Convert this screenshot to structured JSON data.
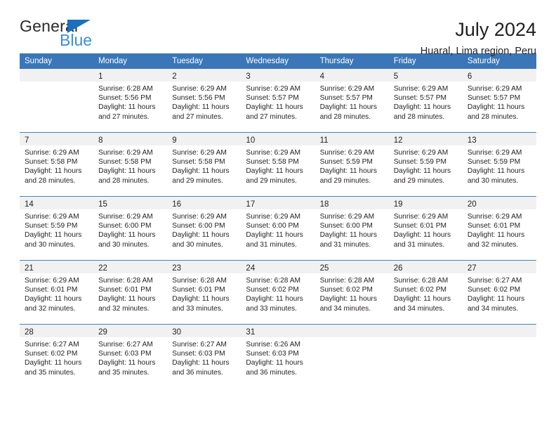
{
  "logo": {
    "word1": "General",
    "word2": "Blue",
    "triangle_color": "#1c6fc0",
    "word2_color": "#3d8dd6"
  },
  "header": {
    "title": "July 2024",
    "subtitle": "Huaral, Lima region, Peru",
    "header_bg": "#3a76b8",
    "daynum_bg": "#f1f1f1",
    "separator_color": "#4a7fbb"
  },
  "weekday_headers": [
    "Sunday",
    "Monday",
    "Tuesday",
    "Wednesday",
    "Thursday",
    "Friday",
    "Saturday"
  ],
  "weeks": [
    [
      {
        "day": "",
        "lines": []
      },
      {
        "day": "1",
        "lines": [
          "Sunrise: 6:28 AM",
          "Sunset: 5:56 PM",
          "Daylight: 11 hours",
          "and 27 minutes."
        ]
      },
      {
        "day": "2",
        "lines": [
          "Sunrise: 6:29 AM",
          "Sunset: 5:56 PM",
          "Daylight: 11 hours",
          "and 27 minutes."
        ]
      },
      {
        "day": "3",
        "lines": [
          "Sunrise: 6:29 AM",
          "Sunset: 5:57 PM",
          "Daylight: 11 hours",
          "and 27 minutes."
        ]
      },
      {
        "day": "4",
        "lines": [
          "Sunrise: 6:29 AM",
          "Sunset: 5:57 PM",
          "Daylight: 11 hours",
          "and 28 minutes."
        ]
      },
      {
        "day": "5",
        "lines": [
          "Sunrise: 6:29 AM",
          "Sunset: 5:57 PM",
          "Daylight: 11 hours",
          "and 28 minutes."
        ]
      },
      {
        "day": "6",
        "lines": [
          "Sunrise: 6:29 AM",
          "Sunset: 5:57 PM",
          "Daylight: 11 hours",
          "and 28 minutes."
        ]
      }
    ],
    [
      {
        "day": "7",
        "lines": [
          "Sunrise: 6:29 AM",
          "Sunset: 5:58 PM",
          "Daylight: 11 hours",
          "and 28 minutes."
        ]
      },
      {
        "day": "8",
        "lines": [
          "Sunrise: 6:29 AM",
          "Sunset: 5:58 PM",
          "Daylight: 11 hours",
          "and 28 minutes."
        ]
      },
      {
        "day": "9",
        "lines": [
          "Sunrise: 6:29 AM",
          "Sunset: 5:58 PM",
          "Daylight: 11 hours",
          "and 29 minutes."
        ]
      },
      {
        "day": "10",
        "lines": [
          "Sunrise: 6:29 AM",
          "Sunset: 5:58 PM",
          "Daylight: 11 hours",
          "and 29 minutes."
        ]
      },
      {
        "day": "11",
        "lines": [
          "Sunrise: 6:29 AM",
          "Sunset: 5:59 PM",
          "Daylight: 11 hours",
          "and 29 minutes."
        ]
      },
      {
        "day": "12",
        "lines": [
          "Sunrise: 6:29 AM",
          "Sunset: 5:59 PM",
          "Daylight: 11 hours",
          "and 29 minutes."
        ]
      },
      {
        "day": "13",
        "lines": [
          "Sunrise: 6:29 AM",
          "Sunset: 5:59 PM",
          "Daylight: 11 hours",
          "and 30 minutes."
        ]
      }
    ],
    [
      {
        "day": "14",
        "lines": [
          "Sunrise: 6:29 AM",
          "Sunset: 5:59 PM",
          "Daylight: 11 hours",
          "and 30 minutes."
        ]
      },
      {
        "day": "15",
        "lines": [
          "Sunrise: 6:29 AM",
          "Sunset: 6:00 PM",
          "Daylight: 11 hours",
          "and 30 minutes."
        ]
      },
      {
        "day": "16",
        "lines": [
          "Sunrise: 6:29 AM",
          "Sunset: 6:00 PM",
          "Daylight: 11 hours",
          "and 30 minutes."
        ]
      },
      {
        "day": "17",
        "lines": [
          "Sunrise: 6:29 AM",
          "Sunset: 6:00 PM",
          "Daylight: 11 hours",
          "and 31 minutes."
        ]
      },
      {
        "day": "18",
        "lines": [
          "Sunrise: 6:29 AM",
          "Sunset: 6:00 PM",
          "Daylight: 11 hours",
          "and 31 minutes."
        ]
      },
      {
        "day": "19",
        "lines": [
          "Sunrise: 6:29 AM",
          "Sunset: 6:01 PM",
          "Daylight: 11 hours",
          "and 31 minutes."
        ]
      },
      {
        "day": "20",
        "lines": [
          "Sunrise: 6:29 AM",
          "Sunset: 6:01 PM",
          "Daylight: 11 hours",
          "and 32 minutes."
        ]
      }
    ],
    [
      {
        "day": "21",
        "lines": [
          "Sunrise: 6:29 AM",
          "Sunset: 6:01 PM",
          "Daylight: 11 hours",
          "and 32 minutes."
        ]
      },
      {
        "day": "22",
        "lines": [
          "Sunrise: 6:28 AM",
          "Sunset: 6:01 PM",
          "Daylight: 11 hours",
          "and 32 minutes."
        ]
      },
      {
        "day": "23",
        "lines": [
          "Sunrise: 6:28 AM",
          "Sunset: 6:01 PM",
          "Daylight: 11 hours",
          "and 33 minutes."
        ]
      },
      {
        "day": "24",
        "lines": [
          "Sunrise: 6:28 AM",
          "Sunset: 6:02 PM",
          "Daylight: 11 hours",
          "and 33 minutes."
        ]
      },
      {
        "day": "25",
        "lines": [
          "Sunrise: 6:28 AM",
          "Sunset: 6:02 PM",
          "Daylight: 11 hours",
          "and 34 minutes."
        ]
      },
      {
        "day": "26",
        "lines": [
          "Sunrise: 6:28 AM",
          "Sunset: 6:02 PM",
          "Daylight: 11 hours",
          "and 34 minutes."
        ]
      },
      {
        "day": "27",
        "lines": [
          "Sunrise: 6:27 AM",
          "Sunset: 6:02 PM",
          "Daylight: 11 hours",
          "and 34 minutes."
        ]
      }
    ],
    [
      {
        "day": "28",
        "lines": [
          "Sunrise: 6:27 AM",
          "Sunset: 6:02 PM",
          "Daylight: 11 hours",
          "and 35 minutes."
        ]
      },
      {
        "day": "29",
        "lines": [
          "Sunrise: 6:27 AM",
          "Sunset: 6:03 PM",
          "Daylight: 11 hours",
          "and 35 minutes."
        ]
      },
      {
        "day": "30",
        "lines": [
          "Sunrise: 6:27 AM",
          "Sunset: 6:03 PM",
          "Daylight: 11 hours",
          "and 36 minutes."
        ]
      },
      {
        "day": "31",
        "lines": [
          "Sunrise: 6:26 AM",
          "Sunset: 6:03 PM",
          "Daylight: 11 hours",
          "and 36 minutes."
        ]
      },
      {
        "day": "",
        "lines": []
      },
      {
        "day": "",
        "lines": []
      },
      {
        "day": "",
        "lines": []
      }
    ]
  ]
}
